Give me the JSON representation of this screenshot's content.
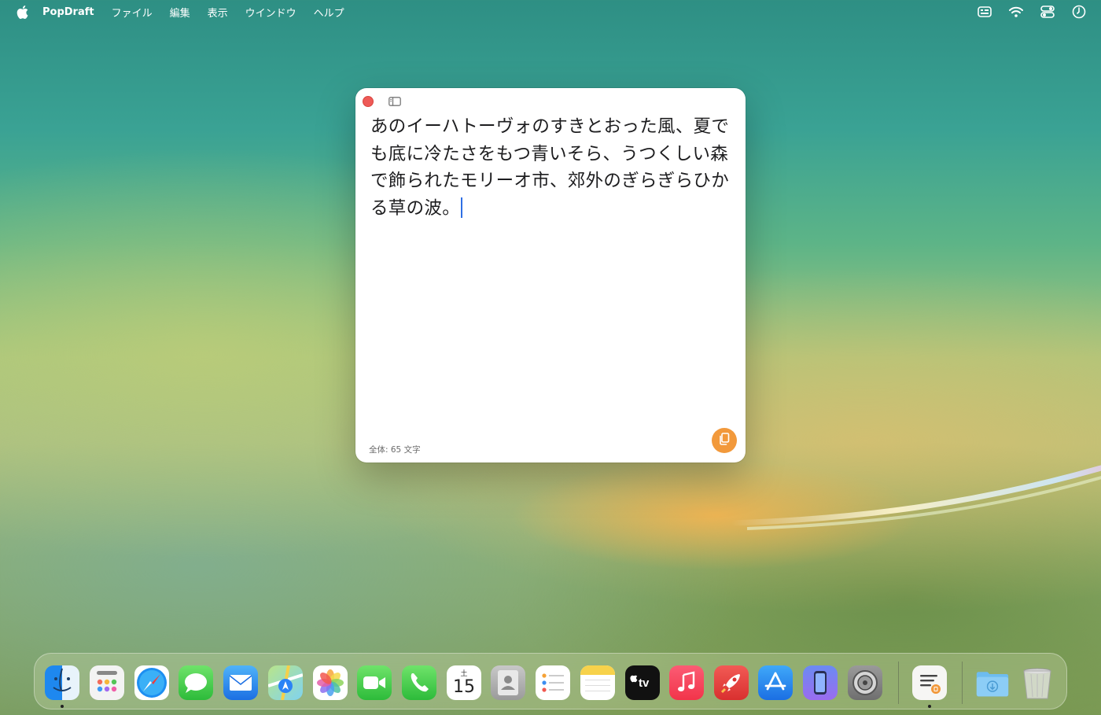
{
  "menubar": {
    "apple_icon": "apple-logo-icon",
    "app_name": "PopDraft",
    "items": [
      "ファイル",
      "編集",
      "表示",
      "ウインドウ",
      "ヘルプ"
    ],
    "status_icons": [
      "keyboard-icon",
      "wifi-icon",
      "control-center-icon",
      "clock-icon"
    ]
  },
  "window": {
    "text": "あのイーハトーヴォのすきとおった風、夏でも底に冷たさをもつ青いそら、うつくしい森で飾られたモリーオ市、郊外のぎらぎらひかる草の波。",
    "char_count": "全体: 65 文字",
    "copy_icon": "copy-icon",
    "accent_color": "#f2993b",
    "close_color": "#ee5a57"
  },
  "dock": {
    "calendar_day": "15",
    "calendar_month": "土",
    "apps": [
      "finder",
      "launchpad",
      "safari",
      "messages",
      "mail",
      "maps",
      "photos",
      "facetime",
      "phone",
      "calendar",
      "contacts",
      "reminders",
      "notes",
      "apple-tv",
      "music",
      "rocket",
      "app-store",
      "iphone-mirroring",
      "system-settings",
      "popdraft",
      "downloads",
      "trash"
    ]
  }
}
